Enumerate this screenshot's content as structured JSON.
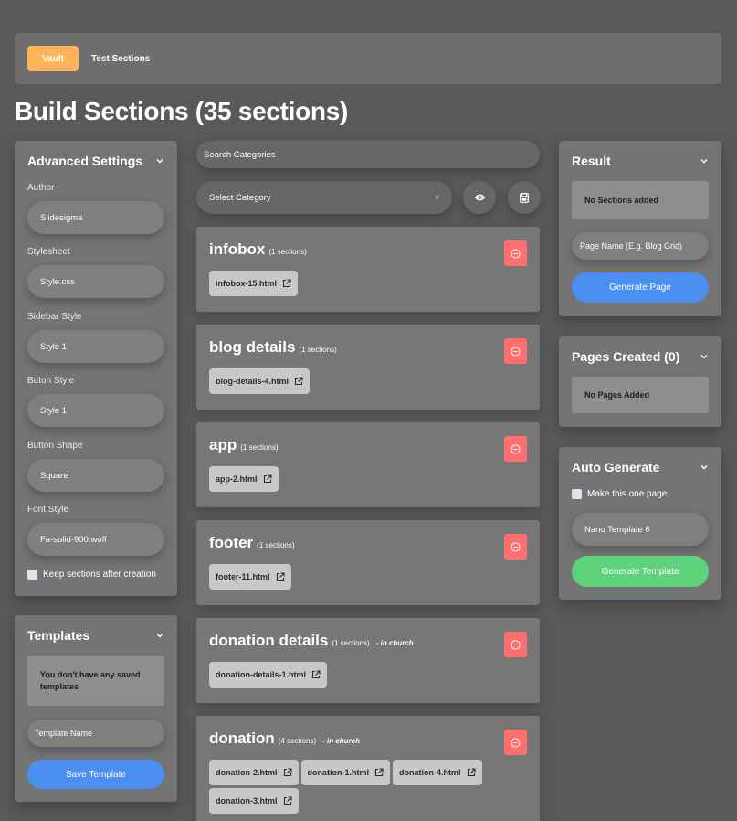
{
  "header": {
    "vault_label": "Vault",
    "crumb_label": "Test Sections"
  },
  "page": {
    "title": "Build Sections (35 sections)"
  },
  "advanced": {
    "title": "Advanced Settings",
    "fields": [
      {
        "label": "Author",
        "value": "Slidesigma"
      },
      {
        "label": "Stylesheet",
        "value": "Style.css"
      },
      {
        "label": "Sidebar Style",
        "value": "Style 1"
      },
      {
        "label": "Buton Style",
        "value": "Style 1"
      },
      {
        "label": "Button Shape",
        "value": "Square"
      },
      {
        "label": "Font Style",
        "value": "Fa-solid-900.woff"
      }
    ],
    "keep_label": "Keep sections after creation"
  },
  "templates": {
    "title": "Templates",
    "empty_notice": "You don't have any saved templates",
    "name_placeholder": "Template Name",
    "save_label": "Save Template"
  },
  "center": {
    "search_placeholder": "Search Categories",
    "select_label": "Select Category",
    "select_arrow": "˅",
    "categories": [
      {
        "name": "infobox",
        "count": "(1 sections)",
        "extra": "",
        "files": [
          "infobox-15.html"
        ]
      },
      {
        "name": "blog details",
        "count": "(1 sections)",
        "extra": "",
        "files": [
          "blog-details-4.html"
        ]
      },
      {
        "name": "app",
        "count": "(1 sections)",
        "extra": "",
        "files": [
          "app-2.html"
        ]
      },
      {
        "name": "footer",
        "count": "(1 sections)",
        "extra": "",
        "files": [
          "footer-11.html"
        ]
      },
      {
        "name": "donation details",
        "count": "(1 sections)",
        "extra": "- in church",
        "files": [
          "donation-details-1.html"
        ]
      },
      {
        "name": "donation",
        "count": "(4 sections)",
        "extra": "- in church",
        "files": [
          "donation-2.html",
          "donation-1.html",
          "donation-4.html",
          "donation-3.html"
        ]
      }
    ]
  },
  "result": {
    "title": "Result",
    "empty_notice": "No Sections added",
    "page_name_placeholder": "Page Name (E.g. Blog Grid)",
    "generate_label": "Generate Page"
  },
  "pages_created": {
    "title": "Pages Created (0)",
    "empty_notice": "No Pages Added"
  },
  "auto_generate": {
    "title": "Auto Generate",
    "one_page_label": "Make this one page",
    "template_value": "Nano Template 6",
    "generate_label": "Generate Template"
  },
  "colors": {
    "accent": "#ffb45a",
    "blue": "#4b8ff0",
    "green": "#5fd27c",
    "danger": "#ff6f6f"
  }
}
